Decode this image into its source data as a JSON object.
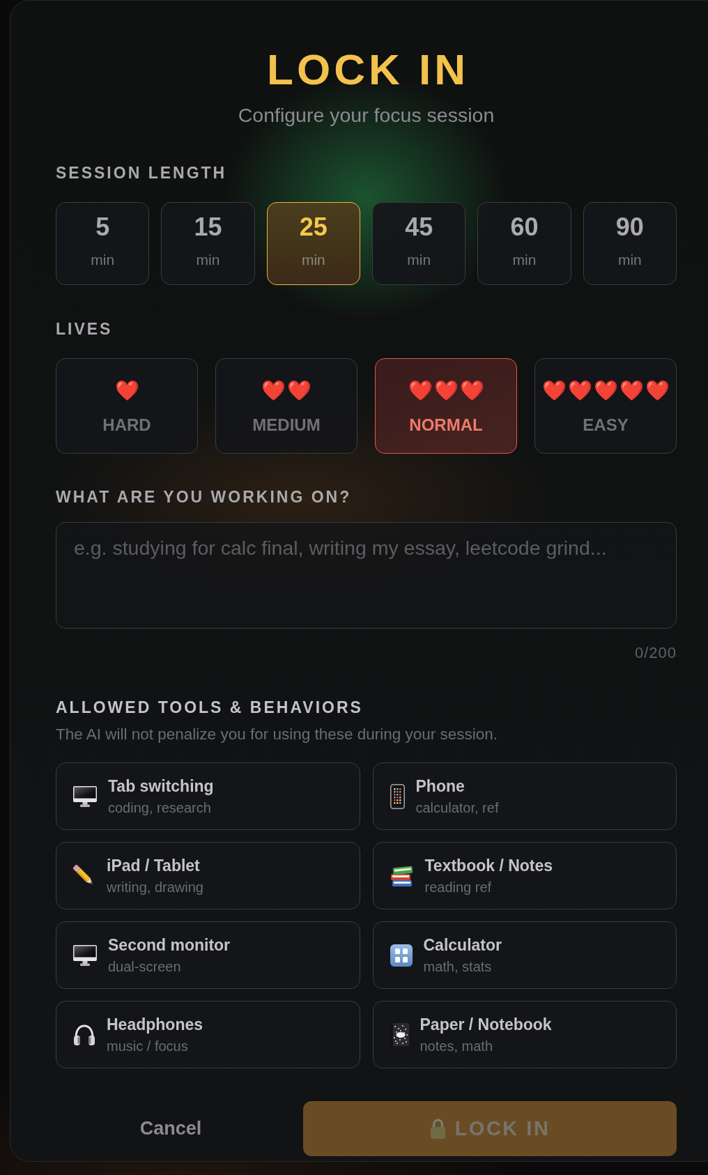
{
  "header": {
    "title": "LOCK IN",
    "subtitle": "Configure your focus session"
  },
  "session_length": {
    "label": "SESSION LENGTH",
    "options": [
      {
        "value": "5",
        "unit": "min",
        "selected": false
      },
      {
        "value": "15",
        "unit": "min",
        "selected": false
      },
      {
        "value": "25",
        "unit": "min",
        "selected": true
      },
      {
        "value": "45",
        "unit": "min",
        "selected": false
      },
      {
        "value": "60",
        "unit": "min",
        "selected": false
      },
      {
        "value": "90",
        "unit": "min",
        "selected": false
      }
    ]
  },
  "lives": {
    "label": "LIVES",
    "options": [
      {
        "hearts": "❤️",
        "label": "HARD",
        "selected": false
      },
      {
        "hearts": "❤️❤️",
        "label": "MEDIUM",
        "selected": false
      },
      {
        "hearts": "❤️❤️❤️",
        "label": "NORMAL",
        "selected": true
      },
      {
        "hearts": "❤️❤️❤️❤️❤️",
        "label": "EASY",
        "selected": false
      }
    ]
  },
  "task": {
    "label": "WHAT ARE YOU WORKING ON?",
    "placeholder": "e.g. studying for calc final, writing my essay, leetcode grind...",
    "counter": "0/200"
  },
  "allowed_tools": {
    "label": "ALLOWED TOOLS & BEHAVIORS",
    "description": "The AI will not penalize you for using these during your session.",
    "items": [
      {
        "kind": "monitor",
        "title": "Tab switching",
        "detail": "coding, research",
        "selected": false
      },
      {
        "kind": "phone",
        "title": "Phone",
        "detail": "calculator, ref",
        "selected": false
      },
      {
        "kind": "pencil",
        "title": "iPad / Tablet",
        "detail": "writing, drawing",
        "selected": false
      },
      {
        "kind": "books",
        "title": "Textbook / Notes",
        "detail": "reading ref",
        "selected": false
      },
      {
        "kind": "monitor",
        "title": "Second monitor",
        "detail": "dual-screen",
        "selected": false
      },
      {
        "kind": "keypad",
        "title": "Calculator",
        "detail": "math, stats",
        "selected": false
      },
      {
        "kind": "headphones",
        "title": "Headphones",
        "detail": "music / focus",
        "selected": false
      },
      {
        "kind": "notebook",
        "title": "Paper / Notebook",
        "detail": "notes, math",
        "selected": false
      }
    ]
  },
  "footer": {
    "cancel": "Cancel",
    "lock_button": {
      "label": "LOCK IN",
      "disabled": true
    }
  }
}
